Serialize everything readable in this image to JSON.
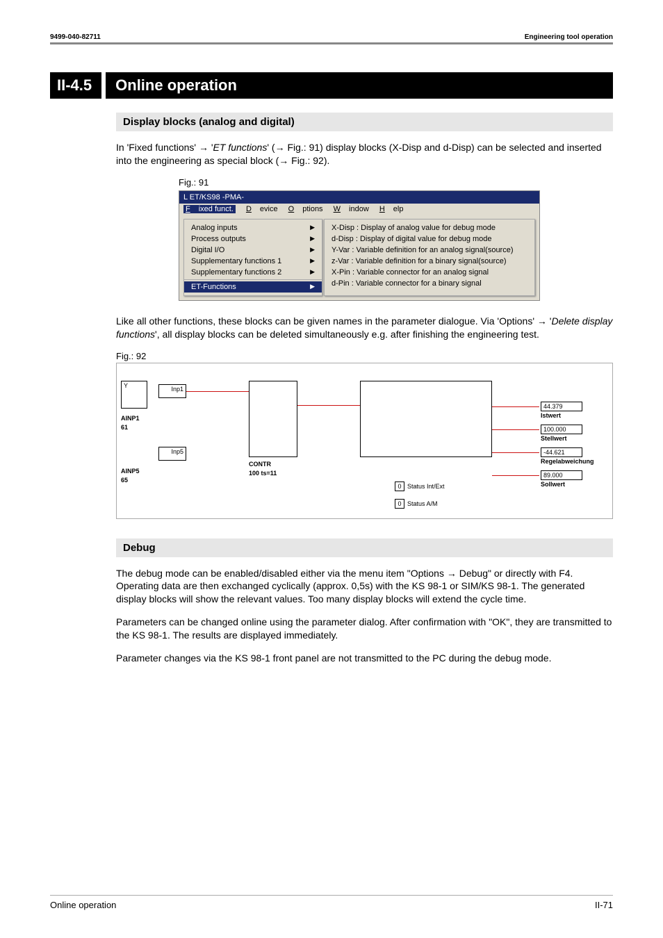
{
  "header": {
    "left": "9499-040-82711",
    "right": "Engineering tool operation"
  },
  "section": {
    "number": "II-4.5",
    "title": "Online operation"
  },
  "sub1": {
    "heading": "Display blocks (analog and digital)",
    "para_parts": {
      "p1": "In 'Fixed functions' → '",
      "p2": "ET functions",
      "p3": "' (→ Fig.: 91) display blocks (X-Disp and d-Disp) can be selected and inserted into the engineering as special block (→ Fig.: 92)."
    }
  },
  "fig91": {
    "label": "Fig.: 91",
    "win_title": "L ET/KS98 -PMA-",
    "menus": {
      "fixed": "Fixed funct.",
      "device": "Device",
      "options": "Options",
      "window": "Window",
      "help": "Help"
    },
    "left_items": [
      "Analog inputs",
      "Process outputs",
      "Digital I/O",
      "Supplementary functions 1",
      "Supplementary functions 2"
    ],
    "left_selected": "ET-Functions",
    "right_items": [
      "X-Disp : Display of analog value for debug mode",
      "d-Disp : Display of digital value for debug mode",
      "Y-Var : Variable definition for an analog signal(source)",
      "z-Var : Variable definition for a binary signal(source)",
      "X-Pin : Variable connector for an analog signal",
      "d-Pin : Variable connector for a binary signal"
    ]
  },
  "between": {
    "p1": "Like all other functions, these blocks can be given names in the parameter dialogue. Via 'Options' → '",
    "p2": "Delete display functions",
    "p3": "', all display blocks can be deleted simultaneously e.g. after finishing the engineering test."
  },
  "fig92": {
    "label": "Fig.: 92",
    "left_blocks": {
      "ainp1": "AINP1",
      "n61": "61",
      "inp1": "Inp1",
      "inp5": "Inp5",
      "ainp5": "AINP5",
      "n65": "65"
    },
    "mid": {
      "contr": "CONTR",
      "ts": "100 ts=11"
    },
    "status1": "Status Int/Ext",
    "status2": "Status A/M",
    "right": [
      {
        "val": "44.379",
        "lbl": "Istwert"
      },
      {
        "val": "100.000",
        "lbl": "Stellwert"
      },
      {
        "val": "-44.621",
        "lbl": "Regelabweichung"
      },
      {
        "val": "89.000",
        "lbl": "Sollwert"
      }
    ]
  },
  "sub2": {
    "heading": "Debug",
    "p1": "The debug mode can be enabled/disabled either via the menu item \"Options → Debug\" or directly with F4. Operating data are then exchanged cyclically (approx. 0,5s) with the KS 98-1 or SIM/KS 98-1. The generated display blocks will show the relevant values. Too many display blocks will extend the cycle time.",
    "p2": "Parameters can be changed online using the parameter dialog. After confirmation with \"OK\", they are transmitted to the KS 98-1. The results are displayed immediately.",
    "p3": "Parameter changes via the KS 98-1 front panel are not transmitted to the PC during the debug mode."
  },
  "footer": {
    "left": "Online operation",
    "right": "II-71"
  }
}
